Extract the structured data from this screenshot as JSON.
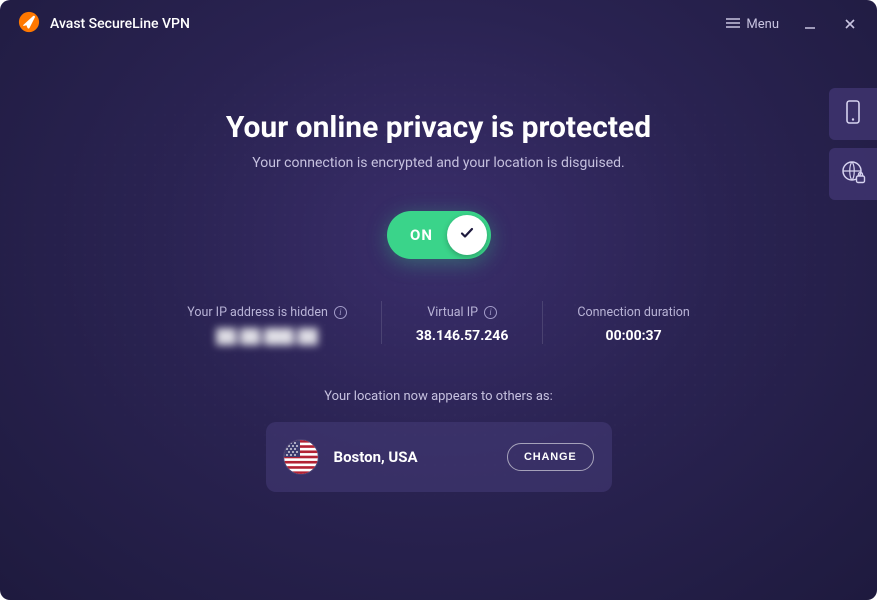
{
  "titlebar": {
    "app_name": "Avast SecureLine VPN",
    "menu_label": "Menu"
  },
  "main": {
    "headline": "Your online privacy is protected",
    "subhead": "Your connection is encrypted and your location is disguised."
  },
  "toggle": {
    "state_label": "ON",
    "on": true
  },
  "stats": {
    "real_ip": {
      "label": "Your IP address is hidden",
      "value": "██.██.███.██"
    },
    "virtual_ip": {
      "label": "Virtual IP",
      "value": "38.146.57.246"
    },
    "duration": {
      "label": "Connection duration",
      "value": "00:00:37"
    }
  },
  "location": {
    "caption": "Your location now appears to others as:",
    "name": "Boston, USA",
    "flag": "us",
    "change_label": "CHANGE"
  },
  "colors": {
    "accent_green": "#3ad48a",
    "bg_purple_dark": "#1e1a3e",
    "bg_purple_mid": "#3a2e6b",
    "card_purple": "rgba(70,60,120,0.55)"
  }
}
